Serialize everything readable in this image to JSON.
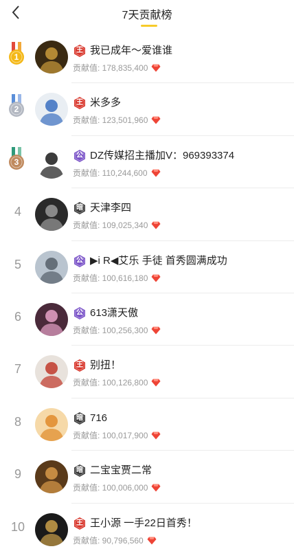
{
  "header": {
    "title": "7天贡献榜"
  },
  "colors": {
    "accent": "#f7cb2a",
    "king_badge": "#d8352a",
    "gong_badge": "#7b54c8",
    "an_badge": "#3a3a3a",
    "gem": "#ee4436"
  },
  "list": {
    "contrib_label": "贡献值: ",
    "items": [
      {
        "rank": "1",
        "medal": "gold",
        "badge": "王",
        "badge_type": "king",
        "name": "我已成年～爱谁谁",
        "contrib": "178,835,400"
      },
      {
        "rank": "2",
        "medal": "silver",
        "badge": "王",
        "badge_type": "king",
        "name": "米多多",
        "contrib": "123,501,960"
      },
      {
        "rank": "3",
        "medal": "bronze",
        "badge": "公",
        "badge_type": "gong",
        "name": "DZ传媒招主播加V：969393374",
        "contrib": "110,244,600"
      },
      {
        "rank": "4",
        "medal": "",
        "badge": "暗",
        "badge_type": "an",
        "name": "天津李四",
        "contrib": "109,025,340"
      },
      {
        "rank": "5",
        "medal": "",
        "badge": "公",
        "badge_type": "gong",
        "name": "▶i R◀艾乐 手徒 首秀圆满成功",
        "contrib": "100,616,180"
      },
      {
        "rank": "6",
        "medal": "",
        "badge": "公",
        "badge_type": "gong",
        "name": "613潇天傲",
        "contrib": "100,256,300"
      },
      {
        "rank": "7",
        "medal": "",
        "badge": "王",
        "badge_type": "king",
        "name": "别扭！",
        "contrib": "100,126,800"
      },
      {
        "rank": "8",
        "medal": "",
        "badge": "暗",
        "badge_type": "an",
        "name": "716",
        "contrib": "100,017,900"
      },
      {
        "rank": "9",
        "medal": "",
        "badge": "暗",
        "badge_type": "an",
        "name": "二宝宝贾二常",
        "contrib": "100,006,000"
      },
      {
        "rank": "10",
        "medal": "",
        "badge": "王",
        "badge_type": "king",
        "name": "王小源 一手22日首秀！",
        "contrib": "90,796,560"
      }
    ]
  }
}
